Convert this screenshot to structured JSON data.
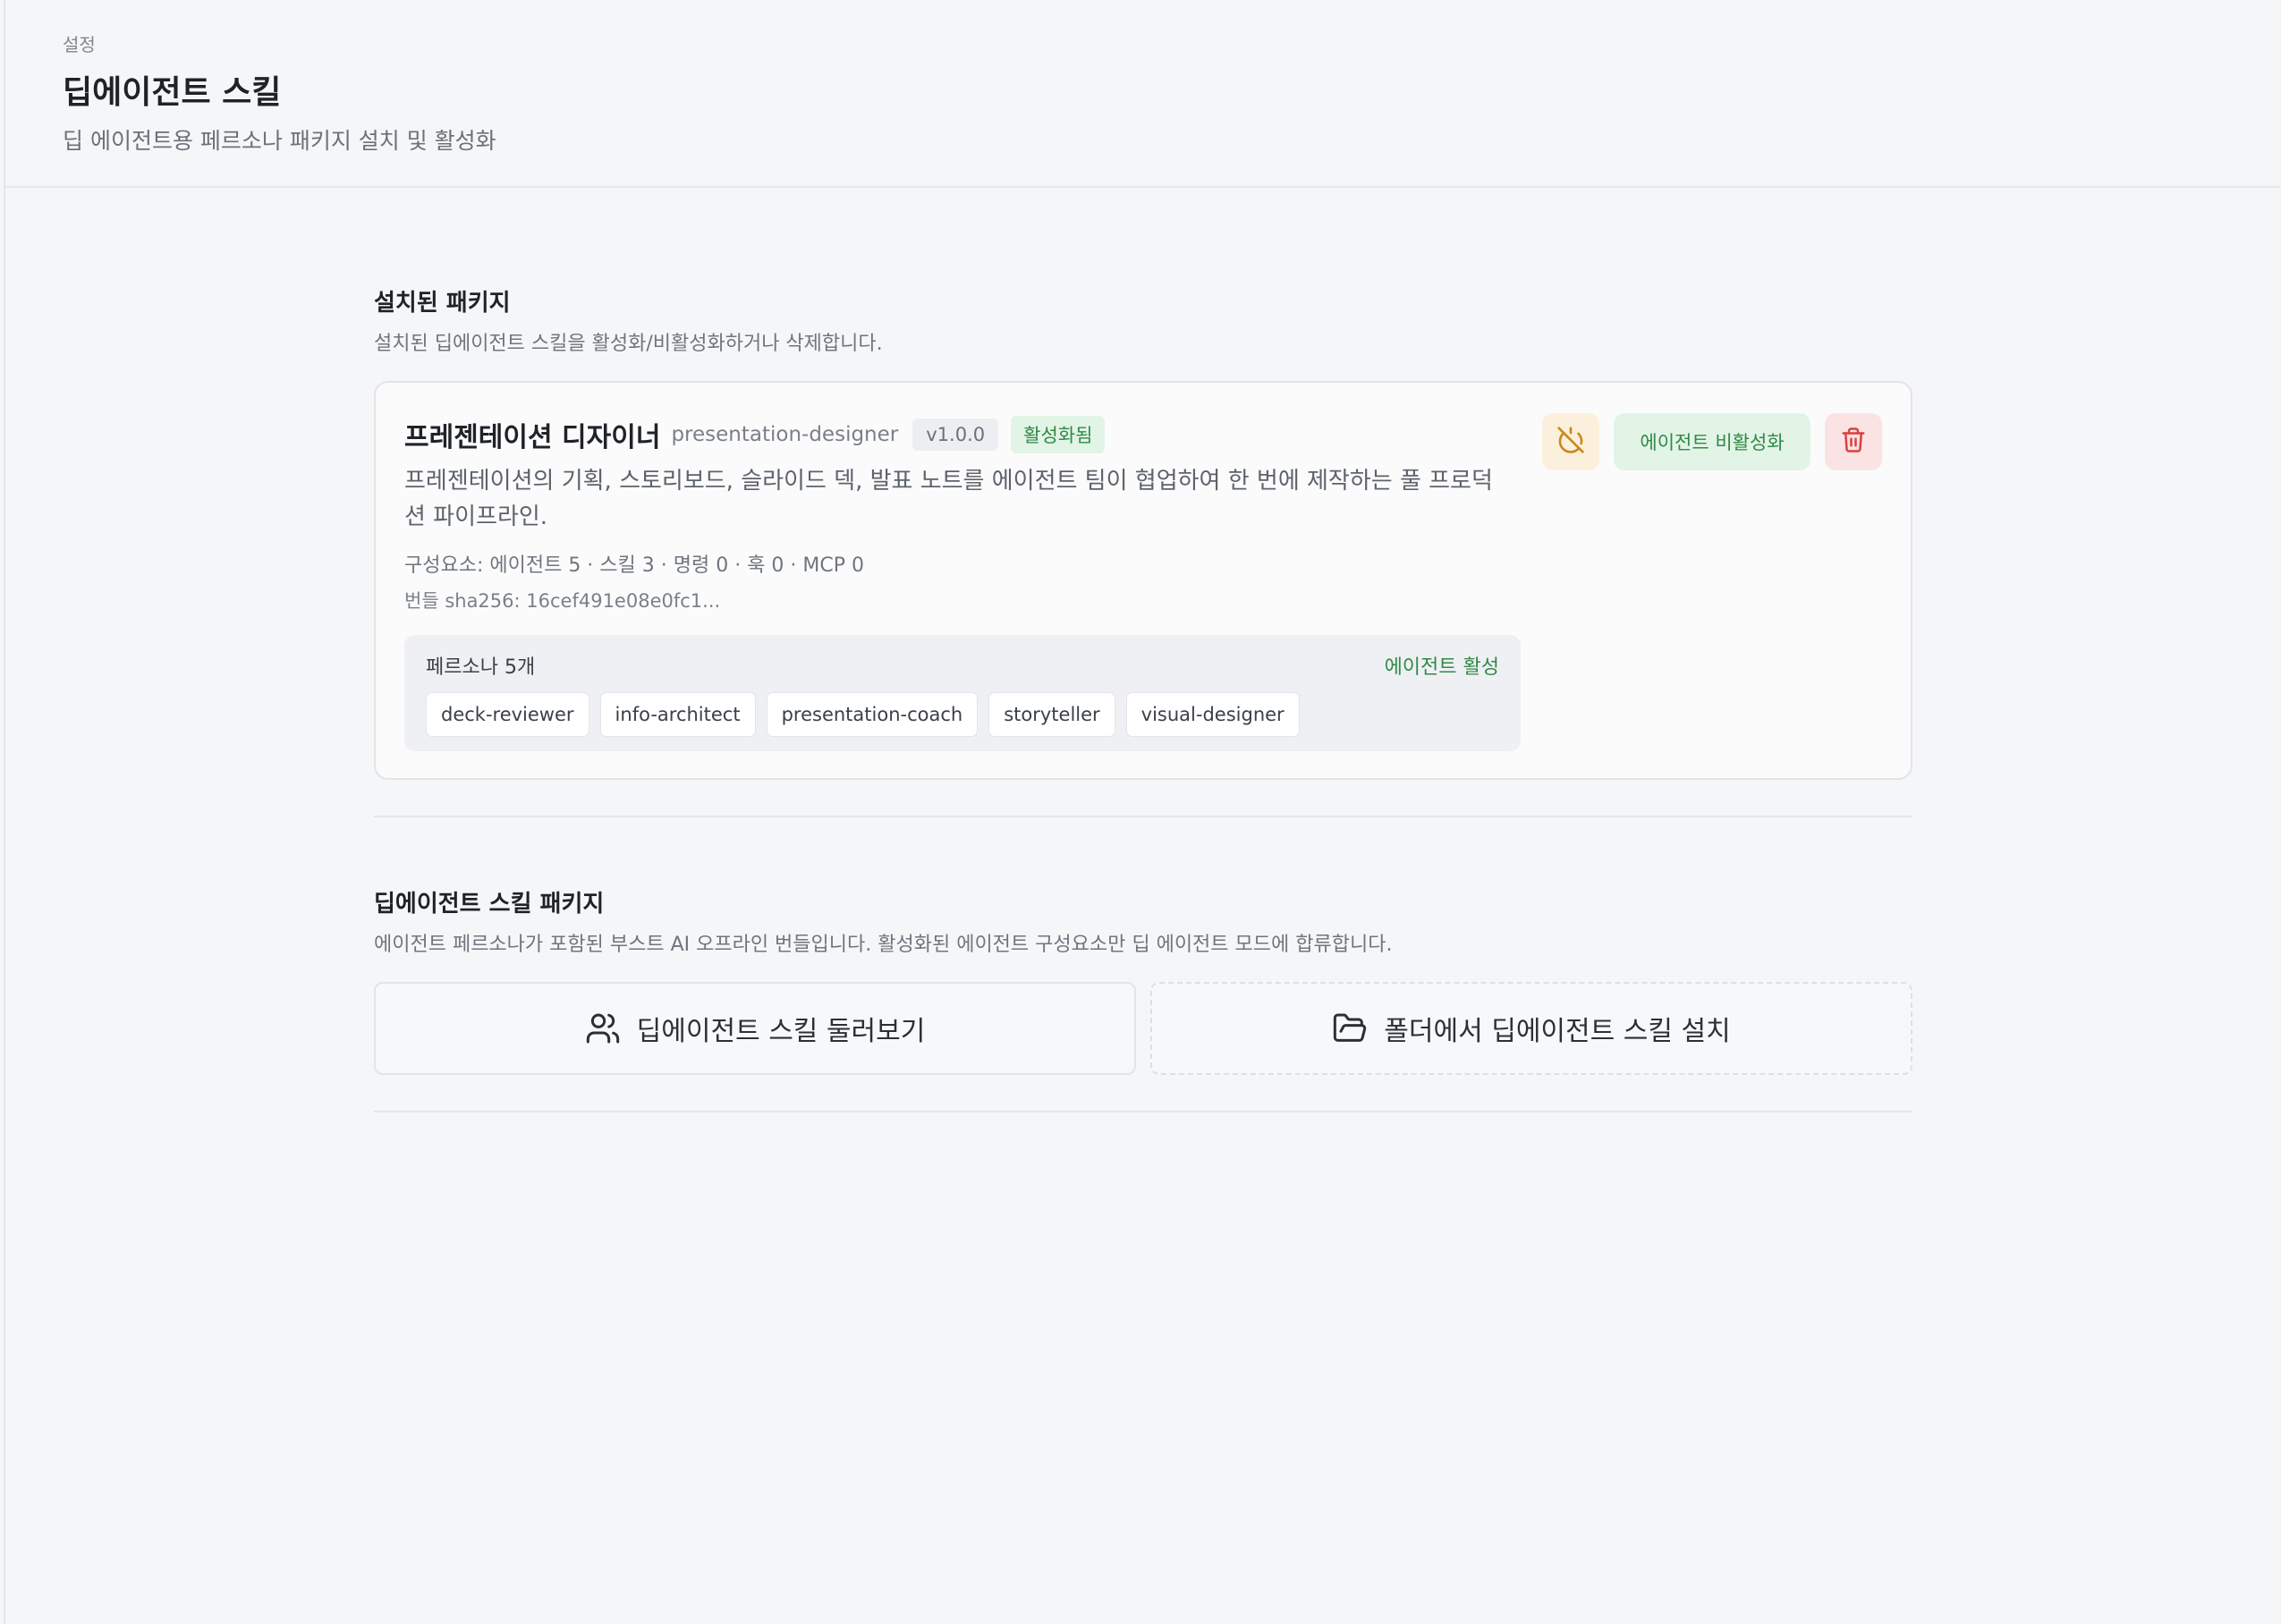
{
  "header": {
    "breadcrumb": "설정",
    "title": "딥에이전트 스킬",
    "subtitle": "딥 에이전트용 페르소나 패키지 설치 및 활성화"
  },
  "installed": {
    "title": "설치된 패키지",
    "description": "설치된 딥에이전트 스킬을 활성화/비활성화하거나 삭제합니다.",
    "package": {
      "name": "프레젠테이션 디자이너",
      "id": "presentation-designer",
      "version": "v1.0.0",
      "status": "활성화됨",
      "description": "프레젠테이션의 기획, 스토리보드, 슬라이드 덱, 발표 노트를 에이전트 팀이 협업하여 한 번에 제작하는 풀 프로덕션 파이프라인.",
      "components": "구성요소: 에이전트 5 · 스킬 3 · 명령 0 · 훅 0 · MCP 0",
      "sha": "번들 sha256: 16cef491e08e0fc1...",
      "deactivate_label": "에이전트 비활성화",
      "personas": {
        "title": "페르소나 5개",
        "active_label": "에이전트 활성",
        "items": [
          "deck-reviewer",
          "info-architect",
          "presentation-coach",
          "storyteller",
          "visual-designer"
        ]
      }
    }
  },
  "packages": {
    "title": "딥에이전트 스킬 패키지",
    "description": "에이전트 페르소나가 포함된 부스트 AI 오프라인 번들입니다. 활성화된 에이전트 구성요소만 딥 에이전트 모드에 합류합니다.",
    "browse_label": "딥에이전트 스킬 둘러보기",
    "install_label": "폴더에서 딥에이전트 스킬 설치"
  },
  "colors": {
    "accent_green": "#2f8a46",
    "warning_amber": "#c98a1a",
    "danger_red": "#d94040"
  },
  "icons": {
    "power": "power-off-icon",
    "delete": "trash-icon",
    "browse": "users-icon",
    "install": "folder-open-icon"
  }
}
